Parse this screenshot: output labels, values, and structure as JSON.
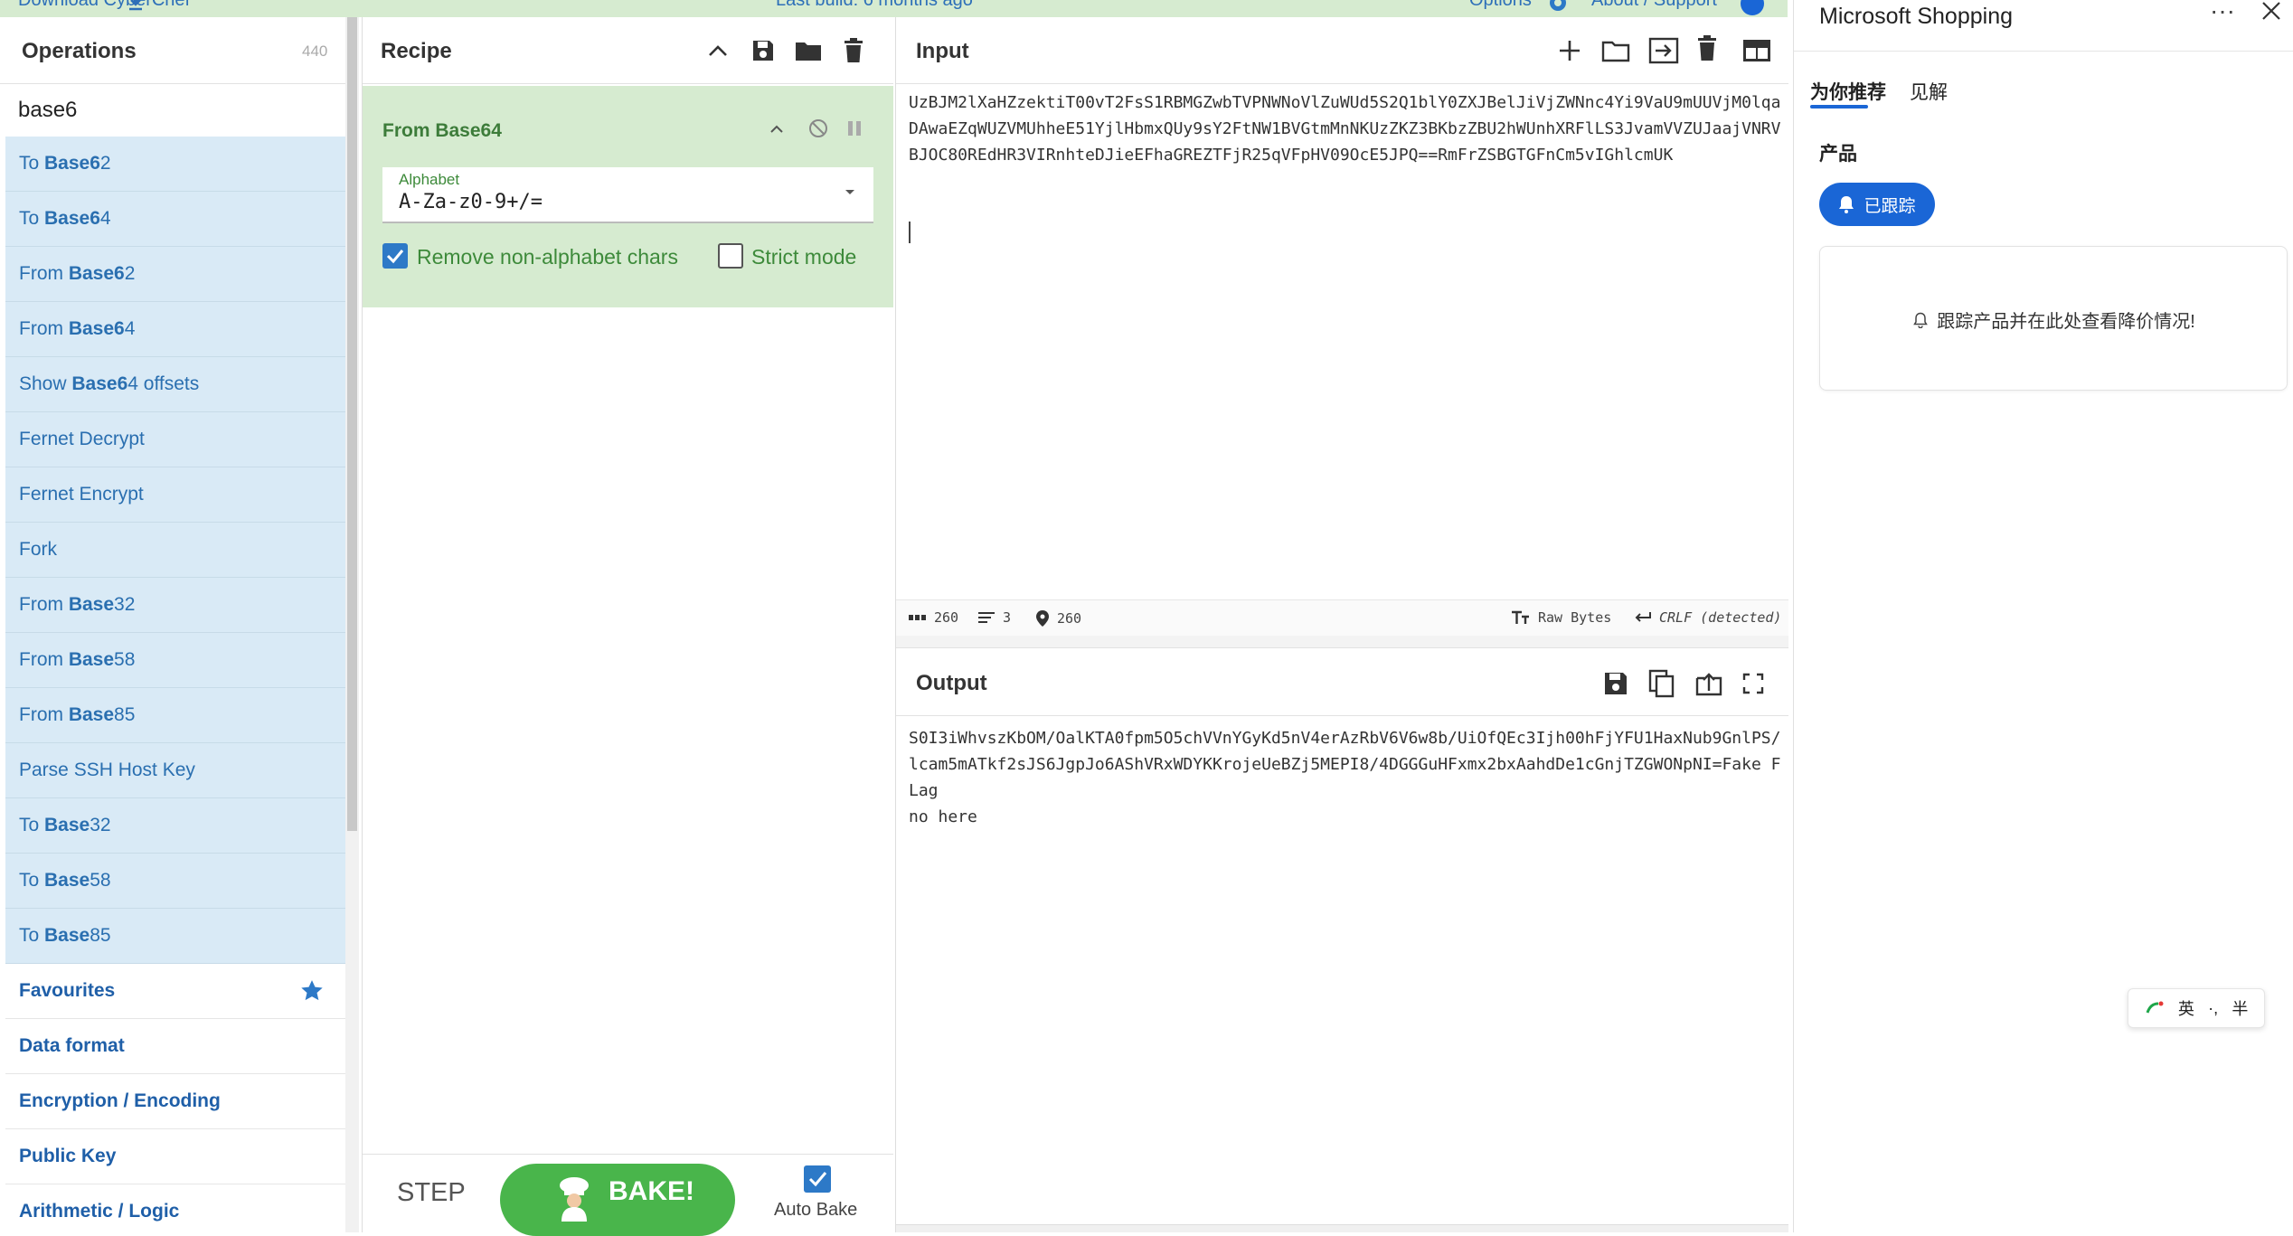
{
  "topbar": {
    "download": "Download CyberChef",
    "build": "Last build: 6 months ago",
    "options": "Options",
    "about": "About / Support"
  },
  "operations": {
    "title": "Operations",
    "count": "440",
    "search_value": "base6",
    "results": [
      {
        "pre": "To ",
        "match": "Base6",
        "post": "2"
      },
      {
        "pre": "To ",
        "match": "Base6",
        "post": "4"
      },
      {
        "pre": "From ",
        "match": "Base6",
        "post": "2"
      },
      {
        "pre": "From ",
        "match": "Base6",
        "post": "4"
      },
      {
        "pre": "Show ",
        "match": "Base6",
        "post": "4 offsets"
      },
      {
        "pre": "Fernet Decrypt",
        "match": "",
        "post": ""
      },
      {
        "pre": "Fernet Encrypt",
        "match": "",
        "post": ""
      },
      {
        "pre": "Fork",
        "match": "",
        "post": ""
      },
      {
        "pre": "From ",
        "match": "Base",
        "post": "32"
      },
      {
        "pre": "From ",
        "match": "Base",
        "post": "58"
      },
      {
        "pre": "From ",
        "match": "Base",
        "post": "85"
      },
      {
        "pre": "Parse SSH Host Key",
        "match": "",
        "post": ""
      },
      {
        "pre": "To ",
        "match": "Base",
        "post": "32"
      },
      {
        "pre": "To ",
        "match": "Base",
        "post": "58"
      },
      {
        "pre": "To ",
        "match": "Base",
        "post": "85"
      }
    ],
    "categories": [
      "Favourites",
      "Data format",
      "Encryption / Encoding",
      "Public Key",
      "Arithmetic / Logic"
    ]
  },
  "recipe": {
    "title": "Recipe",
    "operation_name": "From Base64",
    "alphabet_label": "Alphabet",
    "alphabet_value": "A-Za-z0-9+/=",
    "remove_nonalpha_label": "Remove non-alphabet chars",
    "strict_mode_label": "Strict mode",
    "step_label": "STEP",
    "bake_label": "BAKE!",
    "autobake_label": "Auto Bake"
  },
  "input": {
    "title": "Input",
    "text": "UzBJM2lXaHZzektiT00vT2FsS1RBMGZwbTVPNWNoVlZuWUd5S2Q1blY0ZXJBelJiVjZWNnc4Yi9VaU9mUUVjM0lqaDAwaEZqWUZVMUhheE51YjlHbmxQUy9sY2FtNW1BVGtmMnNKUzZKZ3BKbzZBU2hWUnhXRFlLS3JvamVVZUJaajVNRVBJOC80REdHR3VIRnhteDJieEFhaGREZTFjR25qVFpHV09OcE5JPQ==RmFrZSBGTGFnCm5vIGhlcmUK",
    "status_chars": "260",
    "status_lines": "3",
    "status_pos": "260",
    "status_format": "Raw Bytes",
    "status_eol": "CRLF (detected)"
  },
  "output": {
    "title": "Output",
    "text": "S0I3iWhvszKbOM/OalKTA0fpm5O5chVVnYGyKd5nV4erAzRbV6V6w8b/UiOfQEc3Ijh00hFjYFU1HaxNub9GnlPS/lcam5mATkf2sJS6JgpJo6AShVRxWDYKKrojeUeBZj5MEPI8/4DGGGuHFxmx2bxAahdDe1cGnjTZGWONpNI=Fake FLag\nno here"
  },
  "shopping": {
    "title": "Microsoft Shopping",
    "more": "···",
    "tab_recommend": "为你推荐",
    "tab_insights": "见解",
    "section_products": "产品",
    "tracked_button": "已跟踪",
    "track_message": "跟踪产品并在此处查看降价情况!"
  },
  "ime": {
    "lang": "英",
    "punct": "·,",
    "width": "半"
  },
  "colors": {
    "highlight_blue": "#d9eaf6",
    "recipe_green": "#d6ebd0",
    "bake_green": "#49b54b",
    "accent_blue": "#2d79c7",
    "shop_blue": "#1a66d6"
  }
}
